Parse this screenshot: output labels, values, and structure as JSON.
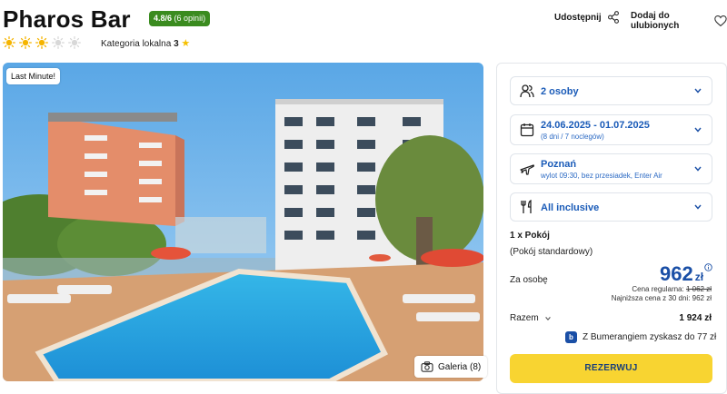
{
  "hotel": {
    "name": "Pharos Bar",
    "rating": "4.8/6",
    "rating_count": "(6 opinii)",
    "suns_filled": 3,
    "suns_total": 5,
    "category_label": "Kategoria lokalna",
    "category_value": "3"
  },
  "actions": {
    "share_label": "Udostępnij",
    "favorite_label": "Dodaj do ulubionych"
  },
  "photo": {
    "badge": "Last Minute!",
    "gallery_label": "Galeria (8)"
  },
  "booking": {
    "persons": "2 osoby",
    "dates": "24.06.2025 - 01.07.2025",
    "dates_sub": "(8 dni / 7 noclegów)",
    "departure": "Poznań",
    "departure_sub": "wylot 09:30, bez przesiadek, Enter Air",
    "board": "All inclusive",
    "room_count": "1 x Pokój",
    "room_type": "(Pokój standardowy)",
    "per_person_label": "Za osobę",
    "price": "962",
    "currency": "zł",
    "regular_label": "Cena regularna:",
    "regular_price": "1 062 zł",
    "lowest_text": "Najniższa cena z 30 dni: 962 zł",
    "total_label": "Razem",
    "total_price": "1 924 zł",
    "bumerang_text": "Z Bumerangiem zyskasz do 77 zł",
    "reserve_label": "REZERWUJ"
  },
  "colors": {
    "rating_bg": "#3a8b1f",
    "accent_blue": "#1a4fa6",
    "button_yellow": "#f8d431",
    "sun_filled": "#f5b400",
    "sun_empty": "#d8d8d8"
  }
}
